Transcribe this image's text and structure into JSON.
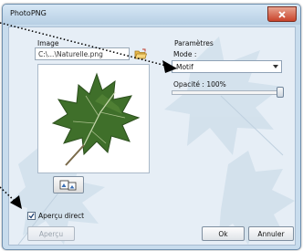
{
  "window": {
    "title": "PhotoPNG"
  },
  "image_section": {
    "label": "Image",
    "path_value": "C:\\...\\Naturelle.png"
  },
  "params_section": {
    "label": "Paramètres",
    "mode_label": "Mode :",
    "mode_value": "Motif",
    "opacity_label": "Opacité : 100%",
    "opacity_value": 1.0
  },
  "preview_option": {
    "label": "Aperçu direct",
    "checked": true
  },
  "buttons": {
    "apercu": "Aperçu",
    "ok": "Ok",
    "annuler": "Annuler"
  }
}
